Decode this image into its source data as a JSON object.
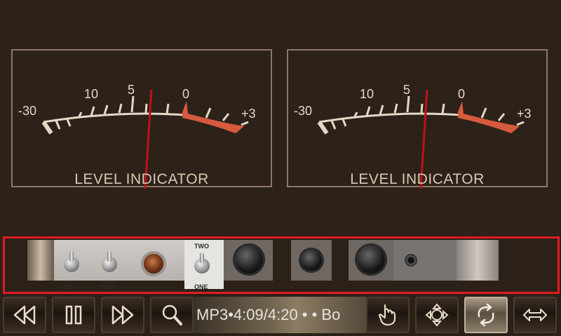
{
  "meters": [
    {
      "label": "LEVEL INDICATOR",
      "scale": [
        "-30",
        "10",
        "5",
        "0",
        "+3"
      ],
      "needle_db": 3.5
    },
    {
      "label": "LEVEL INDICATOR",
      "scale": [
        "-30",
        "10",
        "5",
        "0",
        "+3"
      ],
      "needle_db": 3.5
    }
  ],
  "deck": {
    "switch_labels": {
      "on": "ON",
      "play": "PLAY",
      "two": "TWO",
      "one": "ONE"
    }
  },
  "toolbar": {
    "status_text": "MP3•4:09/4:20 •  • Bo",
    "buttons": [
      {
        "name": "rewind",
        "icon": "rewind-icon"
      },
      {
        "name": "pause",
        "icon": "pause-icon"
      },
      {
        "name": "fast-forward",
        "icon": "fast-forward-icon"
      },
      {
        "name": "search",
        "icon": "search-icon"
      },
      {
        "name": "touch",
        "icon": "hand-pointer-icon"
      },
      {
        "name": "move",
        "icon": "move-arrows-icon"
      },
      {
        "name": "repeat",
        "icon": "repeat-icon",
        "active": true
      },
      {
        "name": "stretch",
        "icon": "horizontal-arrows-icon"
      }
    ]
  },
  "colors": {
    "accent_red": "#e01b24",
    "meter_scale": "#e5d8c6",
    "needle": "#c0101a"
  }
}
